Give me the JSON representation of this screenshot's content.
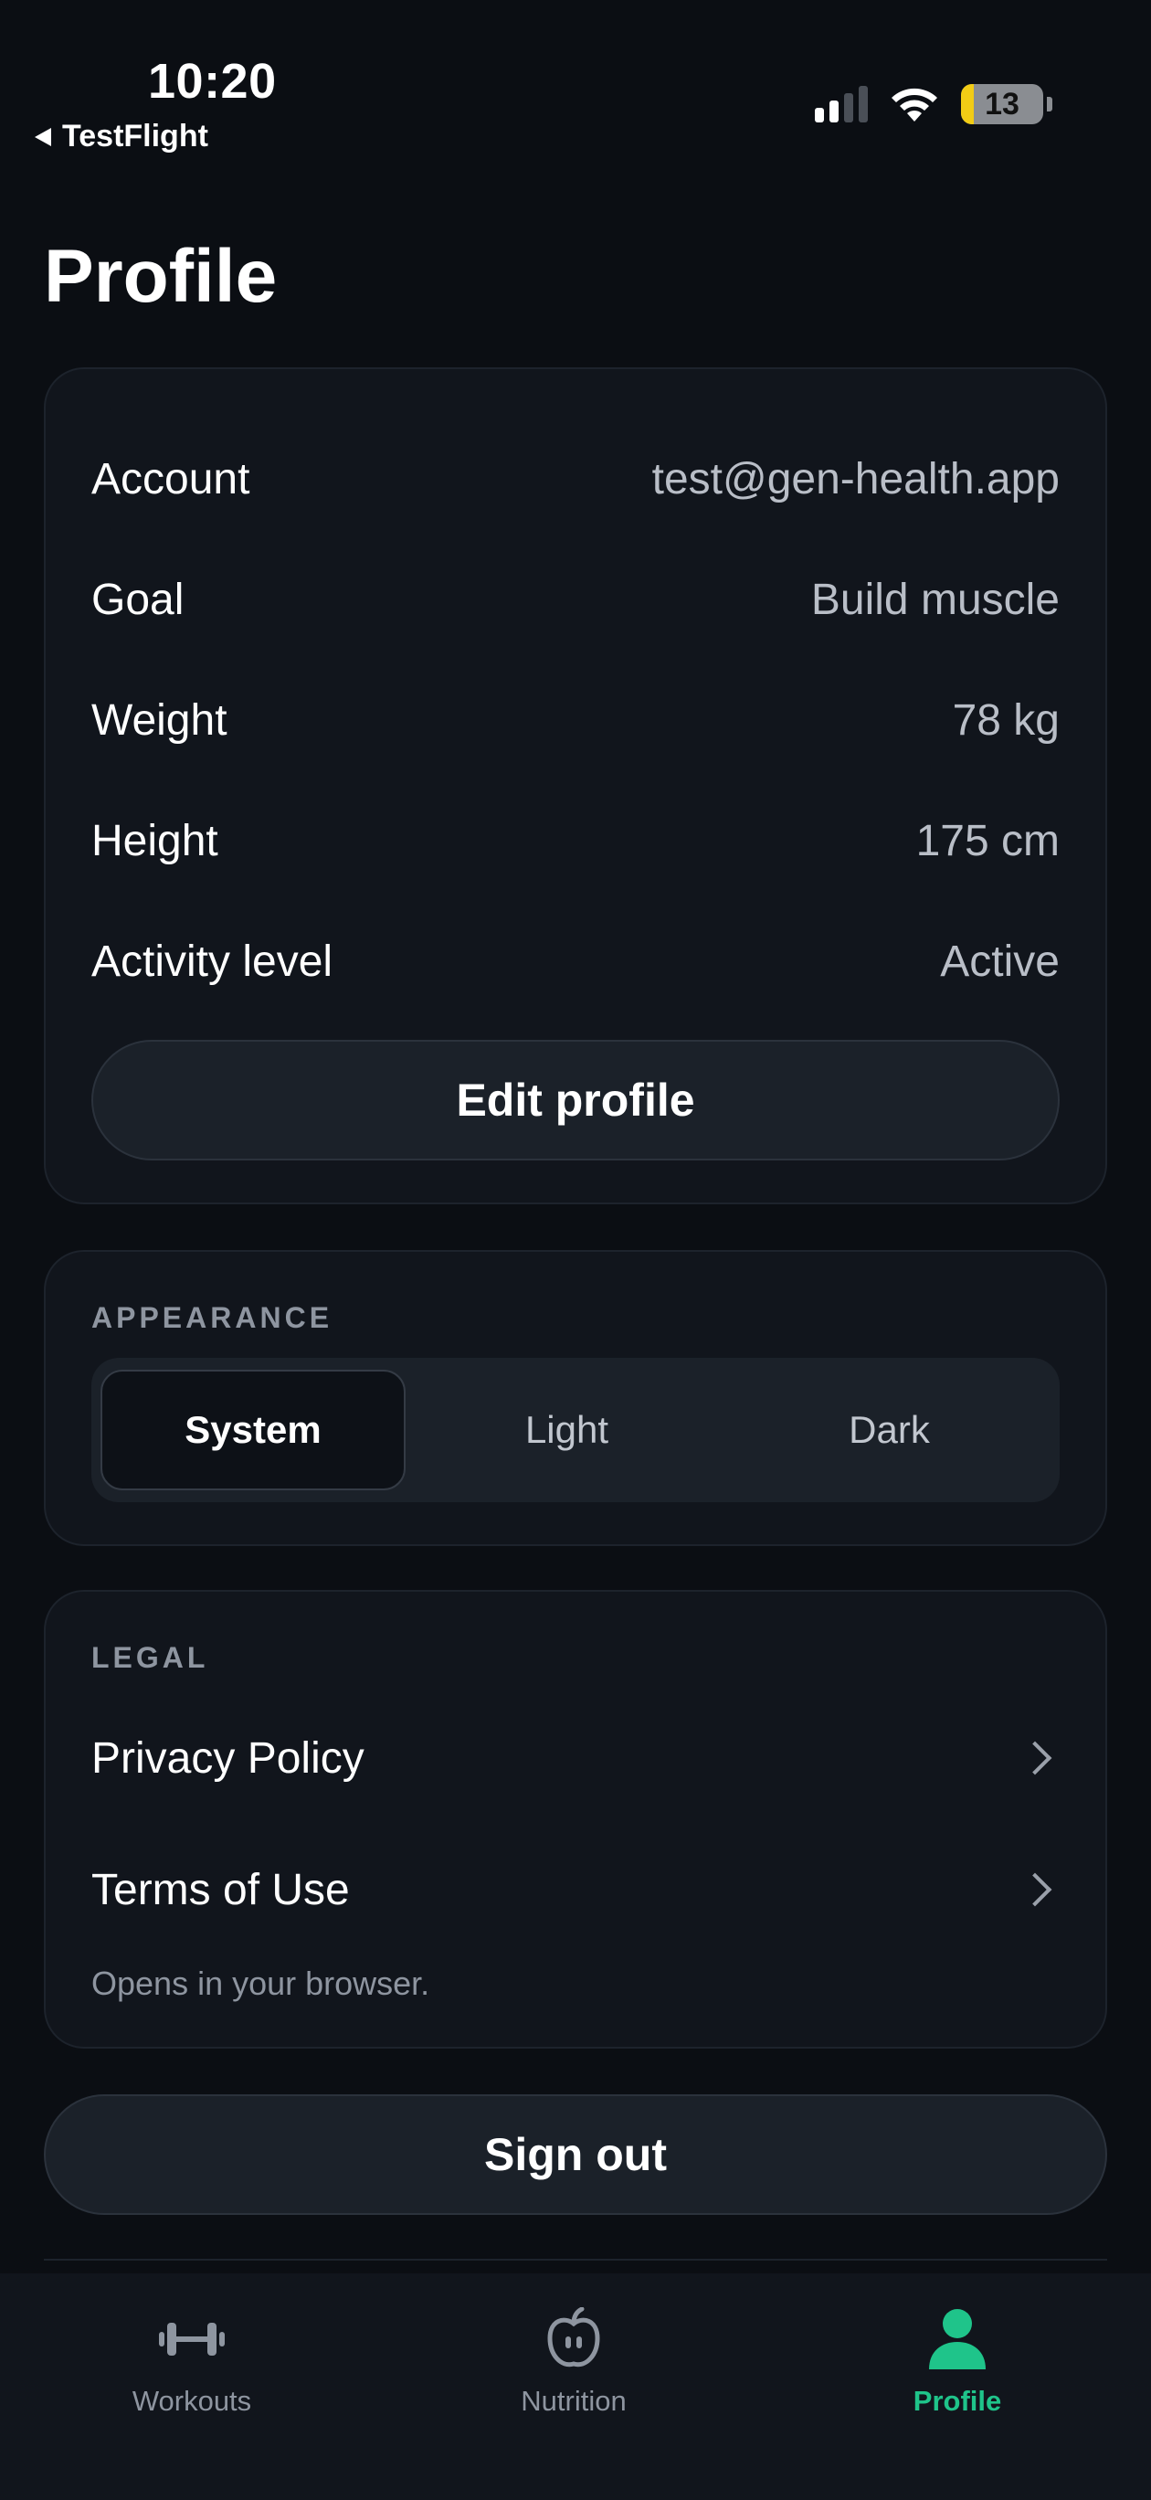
{
  "status_bar": {
    "time": "10:20",
    "back_label": "TestFlight",
    "battery": "13"
  },
  "page_title": "Profile",
  "profile_card": {
    "rows": [
      {
        "label": "Account",
        "value": "test@gen-health.app"
      },
      {
        "label": "Goal",
        "value": "Build muscle"
      },
      {
        "label": "Weight",
        "value": "78 kg"
      },
      {
        "label": "Height",
        "value": "175 cm"
      },
      {
        "label": "Activity level",
        "value": "Active"
      }
    ],
    "edit_button": "Edit profile"
  },
  "appearance": {
    "label": "APPEARANCE",
    "options": [
      "System",
      "Light",
      "Dark"
    ],
    "selected": "System"
  },
  "legal": {
    "label": "LEGAL",
    "links": [
      "Privacy Policy",
      "Terms of Use"
    ],
    "note": "Opens in your browser."
  },
  "sign_out": "Sign out",
  "tabbar": {
    "tabs": [
      {
        "label": "Workouts",
        "icon": "dumbbell-icon"
      },
      {
        "label": "Nutrition",
        "icon": "apple-icon"
      },
      {
        "label": "Profile",
        "icon": "person-icon"
      }
    ],
    "active": "Profile"
  },
  "colors": {
    "background": "#0b0e13",
    "card": "#11151c",
    "accent": "#1fc48a",
    "muted_text": "#8e95a0"
  }
}
